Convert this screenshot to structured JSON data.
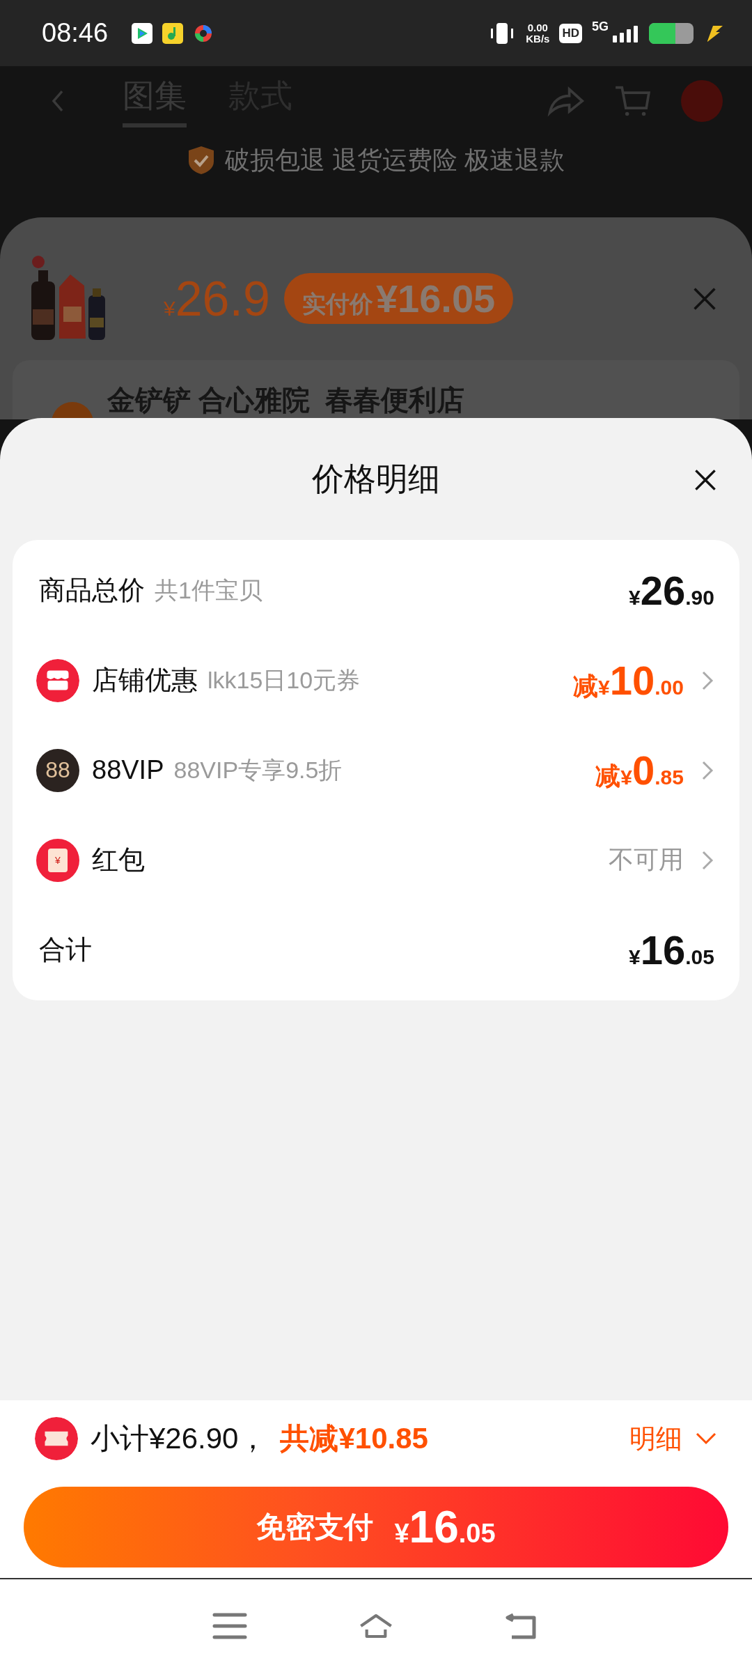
{
  "status_bar": {
    "time": "08:46",
    "speed_value": "0.00",
    "speed_unit": "KB/s",
    "hd": "HD",
    "network": "5G"
  },
  "background_page": {
    "tabs": [
      {
        "label": "图集",
        "selected": true
      },
      {
        "label": "款式",
        "selected": false
      }
    ],
    "guarantee": "破损包退 退货运费险 极速退款"
  },
  "sku_sheet": {
    "price_symbol": "¥",
    "price": "26.9",
    "pay_badge_label": "实付价",
    "pay_badge_price": "¥16.05",
    "shop_name": "金铲铲 合心雅院  春春便利店"
  },
  "price_detail": {
    "title": "价格明细",
    "rows": [
      {
        "kind": "total",
        "label": "商品总价",
        "note": "共1件宝贝",
        "symbol": "¥",
        "amount_int": "26",
        "amount_dec": ".90"
      },
      {
        "kind": "store",
        "label": "店铺优惠",
        "note": "lkk15日10元券",
        "prefix": "减",
        "symbol": "¥",
        "amount_int": "10",
        "amount_dec": ".00"
      },
      {
        "kind": "vip",
        "icon_text": "88",
        "label": "88VIP",
        "note": "88VIP专享9.5折",
        "prefix": "减",
        "symbol": "¥",
        "amount_int": "0",
        "amount_dec": ".85"
      },
      {
        "kind": "packet",
        "icon_text": "¥",
        "label": "红包",
        "value": "不可用"
      },
      {
        "kind": "total",
        "label": "合计",
        "symbol": "¥",
        "amount_int": "16",
        "amount_dec": ".05"
      }
    ]
  },
  "summary_bar": {
    "subtotal": "小计¥26.90，",
    "discount": "共减¥10.85",
    "detail_link": "明细"
  },
  "pay_button": {
    "label": "免密支付",
    "symbol": "¥",
    "amount_int": "16",
    "amount_dec": ".05"
  }
}
